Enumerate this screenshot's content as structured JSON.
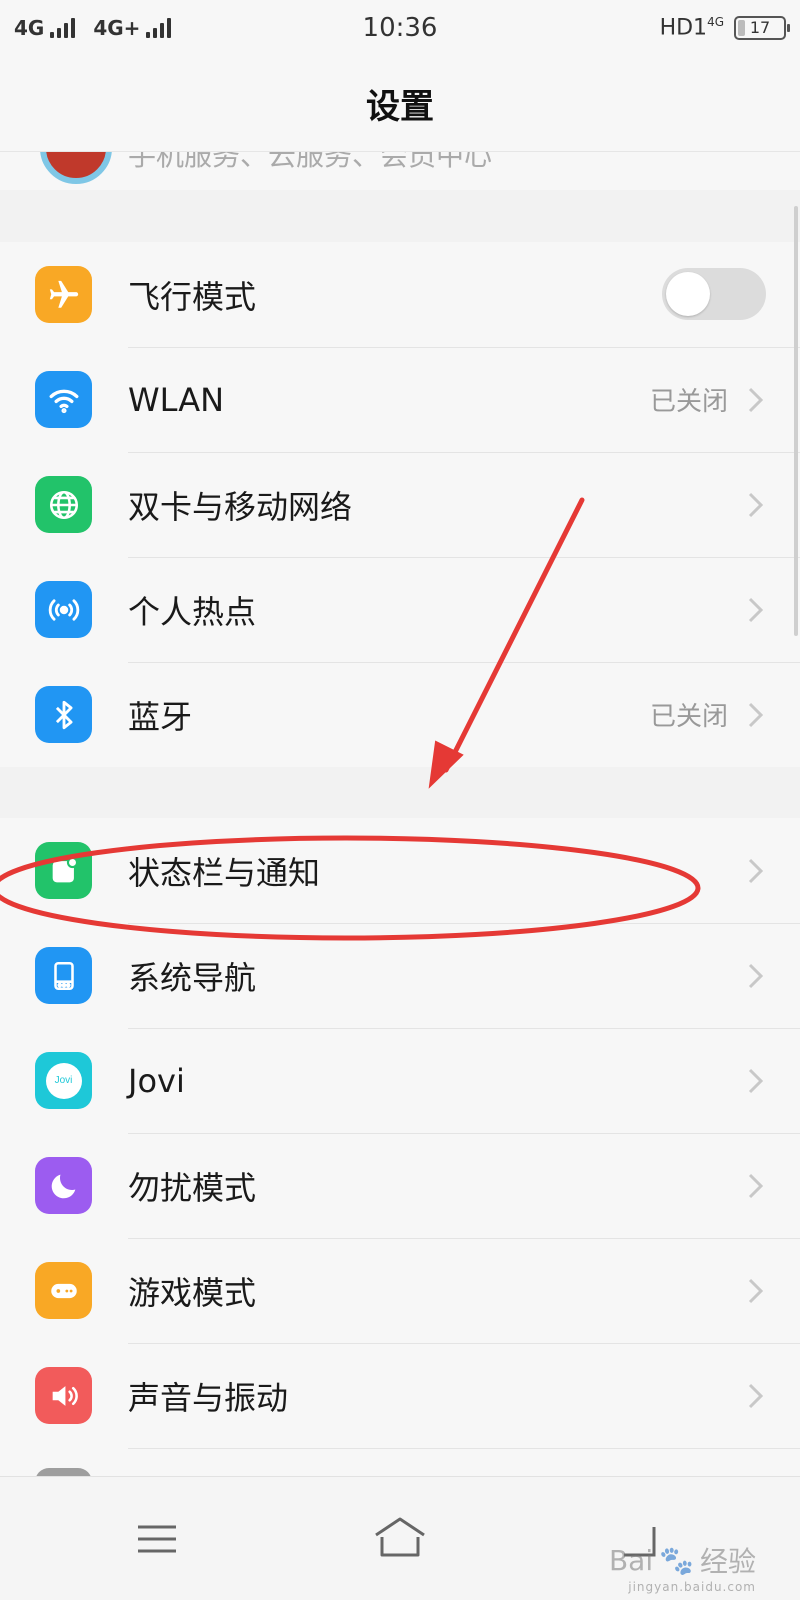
{
  "status_bar": {
    "network1": "4G",
    "network2": "4G+",
    "time": "10:36",
    "right_label": "HD1",
    "right_sub": "4G",
    "battery": "17",
    "battery_level_percent": 17
  },
  "header": {
    "title": "设置"
  },
  "account": {
    "partial_text": "手机服务、云服务、会员中心"
  },
  "settings": {
    "group1": [
      {
        "label": "飞行模式",
        "icon": "airplane-icon",
        "color": "#f9a825",
        "control": "toggle",
        "toggle_on": false
      },
      {
        "label": "WLAN",
        "icon": "wifi-icon",
        "color": "#2196f3",
        "value": "已关闭"
      },
      {
        "label": "双卡与移动网络",
        "icon": "globe-icon",
        "color": "#22c36a"
      },
      {
        "label": "个人热点",
        "icon": "hotspot-icon",
        "color": "#2196f3"
      },
      {
        "label": "蓝牙",
        "icon": "bluetooth-icon",
        "color": "#2196f3",
        "value": "已关闭"
      }
    ],
    "group2": [
      {
        "label": "状态栏与通知",
        "icon": "notification-icon",
        "color": "#22c36a"
      },
      {
        "label": "系统导航",
        "icon": "navigation-icon",
        "color": "#2196f3"
      },
      {
        "label": "Jovi",
        "icon": "jovi-icon",
        "color": "#1ec8d8",
        "icon_text": "Jovi"
      },
      {
        "label": "勿扰模式",
        "icon": "moon-icon",
        "color": "#9c5cf0"
      },
      {
        "label": "游戏模式",
        "icon": "gamepad-icon",
        "color": "#f9a825"
      },
      {
        "label": "声音与振动",
        "icon": "speaker-icon",
        "color": "#f25b5b"
      }
    ]
  },
  "annotation": {
    "color": "#e53935"
  },
  "watermark": {
    "text": "Bai",
    "text2": "经验",
    "sub": "jingyan.baidu.com"
  }
}
